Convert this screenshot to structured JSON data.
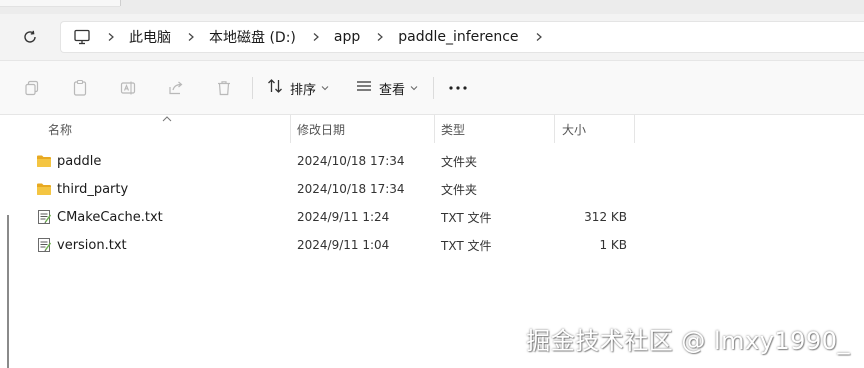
{
  "breadcrumbs": [
    "此电脑",
    "本地磁盘 (D:)",
    "app",
    "paddle_inference"
  ],
  "toolbar": {
    "sort_label": "排序",
    "view_label": "查看"
  },
  "columns": {
    "name": "名称",
    "modified": "修改日期",
    "type": "类型",
    "size": "大小"
  },
  "files": [
    {
      "name": "paddle",
      "modified": "2024/10/18 17:34",
      "type": "文件夹",
      "size": "",
      "icon": "folder-icon"
    },
    {
      "name": "third_party",
      "modified": "2024/10/18 17:34",
      "type": "文件夹",
      "size": "",
      "icon": "folder-icon"
    },
    {
      "name": "CMakeCache.txt",
      "modified": "2024/9/11 1:24",
      "type": "TXT 文件",
      "size": "312 KB",
      "icon": "text-file-icon"
    },
    {
      "name": "version.txt",
      "modified": "2024/9/11 1:04",
      "type": "TXT 文件",
      "size": "1 KB",
      "icon": "text-file-icon"
    }
  ],
  "watermark": "掘金技术社区 @ lmxy1990_",
  "colors": {
    "folder": "#f4c542",
    "background": "#f3f3f3",
    "content": "#ffffff"
  }
}
